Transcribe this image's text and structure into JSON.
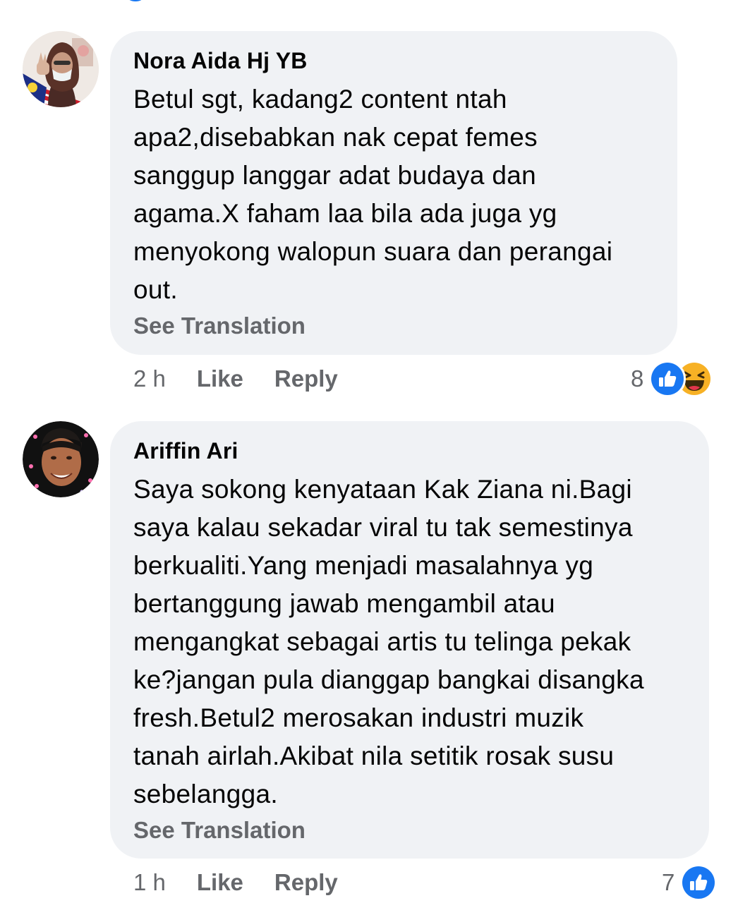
{
  "comments": [
    {
      "author": "Nora Aida Hj YB",
      "text": "Betul sgt, kadang2 content ntah\napa2,disebabkan nak cepat femes\nsanggup langgar adat budaya dan\nagama.X faham laa bila ada juga yg\nmenyokong walopun suara dan perangai\nout.",
      "see_translation": "See Translation",
      "time": "2 h",
      "like_label": "Like",
      "reply_label": "Reply",
      "reaction_count": "8",
      "reactions": [
        "like-icon",
        "haha-icon"
      ]
    },
    {
      "author": "Ariffin Ari",
      "text": "Saya sokong kenyataan Kak Ziana ni.Bagi\nsaya kalau sekadar viral tu tak semestinya\nberkualiti.Yang menjadi masalahnya yg\nbertanggung jawab mengambil atau\nmengangkat sebagai artis tu telinga pekak\nke?jangan pula dianggap bangkai disangka\nfresh.Betul2 merosakan industri muzik\ntanah airlah.Akibat nila setitik rosak susu\nsebelangga.",
      "see_translation": "See Translation",
      "time": "1 h",
      "like_label": "Like",
      "reply_label": "Reply",
      "reaction_count": "7",
      "reactions": [
        "like-icon"
      ]
    }
  ],
  "colors": {
    "bubble": "#f0f2f5",
    "secondary_text": "#65676b",
    "like_blue": "#1877f2",
    "haha_yellow": "#f7b125"
  }
}
